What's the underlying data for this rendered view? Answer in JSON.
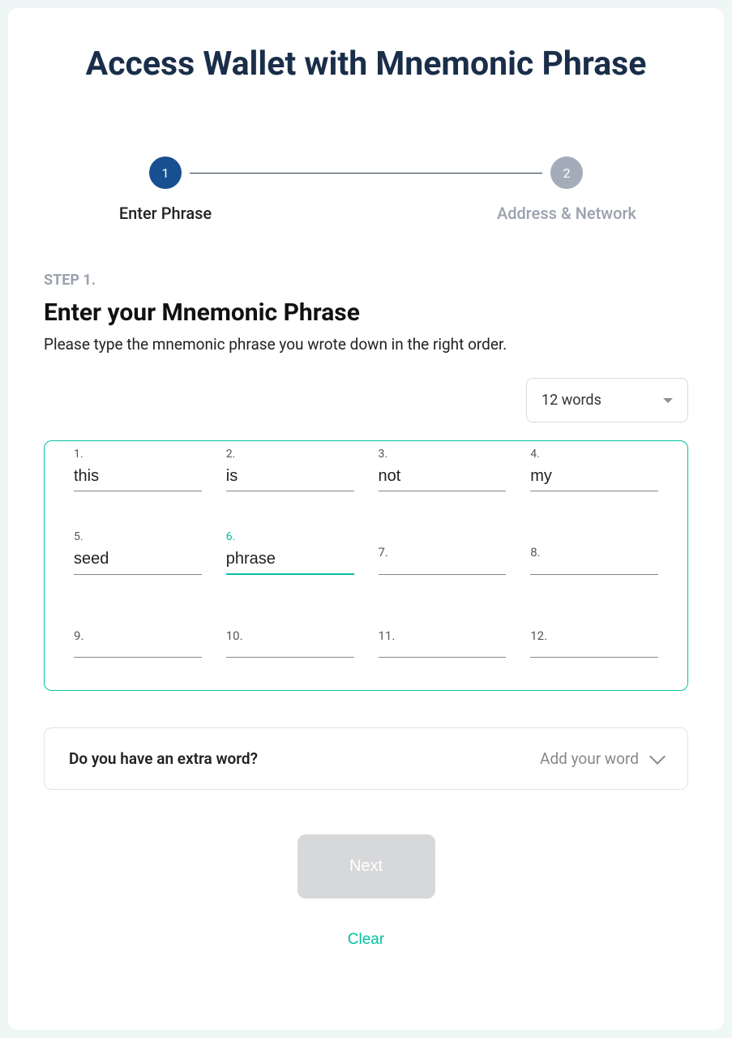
{
  "title": "Access Wallet with Mnemonic Phrase",
  "steps": {
    "s1": {
      "num": "1",
      "label": "Enter Phrase"
    },
    "s2": {
      "num": "2",
      "label": "Address & Network"
    }
  },
  "section": {
    "step_label": "STEP 1.",
    "heading": "Enter your Mnemonic Phrase",
    "desc": "Please type the mnemonic phrase you wrote down in the right order."
  },
  "word_count_select": "12 words",
  "words": {
    "w1": {
      "label": "1.",
      "value": "this"
    },
    "w2": {
      "label": "2.",
      "value": "is"
    },
    "w3": {
      "label": "3.",
      "value": "not"
    },
    "w4": {
      "label": "4.",
      "value": "my"
    },
    "w5": {
      "label": "5.",
      "value": "seed"
    },
    "w6": {
      "label": "6.",
      "value": "phrase"
    },
    "w7": {
      "label": "7.",
      "value": ""
    },
    "w8": {
      "label": "8.",
      "value": ""
    },
    "w9": {
      "label": "9.",
      "value": ""
    },
    "w10": {
      "label": "10.",
      "value": ""
    },
    "w11": {
      "label": "11.",
      "value": ""
    },
    "w12": {
      "label": "12.",
      "value": ""
    }
  },
  "active_word": 6,
  "extra": {
    "question": "Do you have an extra word?",
    "action": "Add your word"
  },
  "buttons": {
    "next": "Next",
    "clear": "Clear"
  }
}
